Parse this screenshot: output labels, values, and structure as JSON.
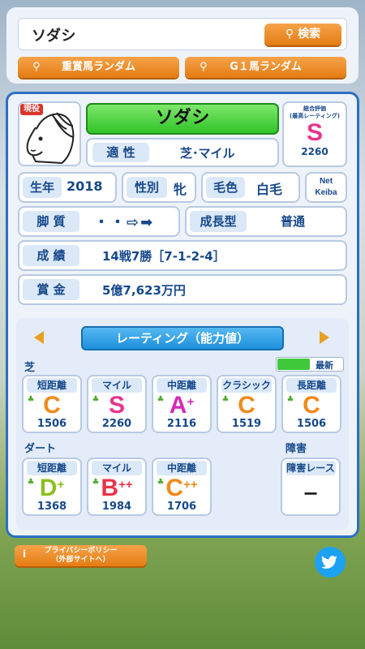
{
  "search": {
    "value": "ソダシ",
    "button": "検索"
  },
  "random": {
    "jusho": "重賞馬ランダム",
    "g1": "G１馬ランダム"
  },
  "horse": {
    "status_badge": "現役",
    "name": "ソダシ",
    "aptitude_label": "適 性",
    "aptitude_value": "芝･マイル",
    "overall_label": "総合評価\n(最高レーティング)",
    "overall_grade": "S",
    "overall_score": "2260",
    "birth_label": "生年",
    "birth_value": "2018",
    "sex_label": "性別",
    "sex_value": "牝",
    "coat_label": "毛色",
    "coat_value": "白毛",
    "netkeiba_line1": "Net",
    "netkeiba_line2": "Keiba",
    "style_label": "脚 質",
    "style_value": "・・⇨➡",
    "growth_label": "成長型",
    "growth_value": "普通",
    "record_label": "成 績",
    "record_value": "14戦7勝［7-1-2-4］",
    "prize_label": "賞 金",
    "prize_value": "5億7,623万円"
  },
  "rating": {
    "title": "レーティング（能力値）",
    "turf_label": "芝",
    "newest_label": "最新",
    "dirt_label": "ダート",
    "obstacle_label": "障害",
    "turf": [
      {
        "label": "短距離",
        "grade": "C",
        "plus": "",
        "score": "1506",
        "color": "#f08a1c"
      },
      {
        "label": "マイル",
        "grade": "S",
        "plus": "",
        "score": "2260",
        "color": "#e8348e"
      },
      {
        "label": "中距離",
        "grade": "A",
        "plus": "+",
        "score": "2116",
        "color": "#d42ab8"
      },
      {
        "label": "クラシック",
        "grade": "C",
        "plus": "",
        "score": "1519",
        "color": "#f08a1c"
      },
      {
        "label": "長距離",
        "grade": "C",
        "plus": "",
        "score": "1506",
        "color": "#f08a1c"
      }
    ],
    "dirt": [
      {
        "label": "短距離",
        "grade": "D",
        "plus": "+",
        "score": "1368",
        "color": "#8cbf1e"
      },
      {
        "label": "マイル",
        "grade": "B",
        "plus": "++",
        "score": "1984",
        "color": "#e8344a"
      },
      {
        "label": "中距離",
        "grade": "C",
        "plus": "++",
        "score": "1706",
        "color": "#f08a1c"
      }
    ],
    "obstacle": {
      "label": "障害レース",
      "value": "−"
    }
  },
  "footer": {
    "privacy_line1": "プライバシーポリシー",
    "privacy_line2": "（外部サイトへ）",
    "info_icon": "i"
  },
  "colors": {
    "accent": "#2c6fc2",
    "orange": "#e98a1e",
    "green": "#3fc83a"
  }
}
